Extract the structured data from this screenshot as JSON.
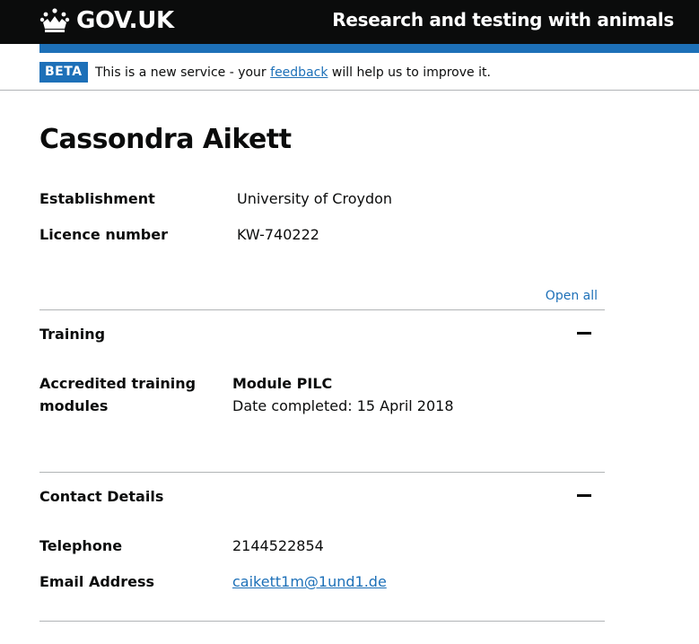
{
  "header": {
    "logo_text": "GOV.UK",
    "service_name": "Research and testing with animals",
    "colors": {
      "background": "#0b0c0c",
      "accent_bar": "#1d70b8"
    }
  },
  "phase_banner": {
    "tag": "BETA",
    "text_before": "This is a new service - your ",
    "link_text": "feedback",
    "text_after": " will help us to improve it."
  },
  "page": {
    "title": "Cassondra Aikett",
    "summary": [
      {
        "key": "Establishment",
        "value": "University of Croydon"
      },
      {
        "key": "Licence number",
        "value": "KW-740222"
      }
    ]
  },
  "accordion": {
    "open_all_label": "Open all",
    "sections": [
      {
        "heading": "Training",
        "toggle_icon": "minus-icon",
        "key_lines": [
          "Accredited training",
          "modules"
        ],
        "module_name": "Module PILC",
        "module_detail": "Date completed: 15 April 2018"
      },
      {
        "heading": "Contact Details",
        "toggle_icon": "minus-icon",
        "rows": [
          {
            "key": "Telephone",
            "value": "2144522854"
          },
          {
            "key": "Email Address",
            "value": "caikett1m@1und1.de"
          }
        ]
      }
    ]
  },
  "colors": {
    "link": "#1d70b8",
    "text": "#0b0c0c",
    "rule": "#b1b4b6"
  }
}
